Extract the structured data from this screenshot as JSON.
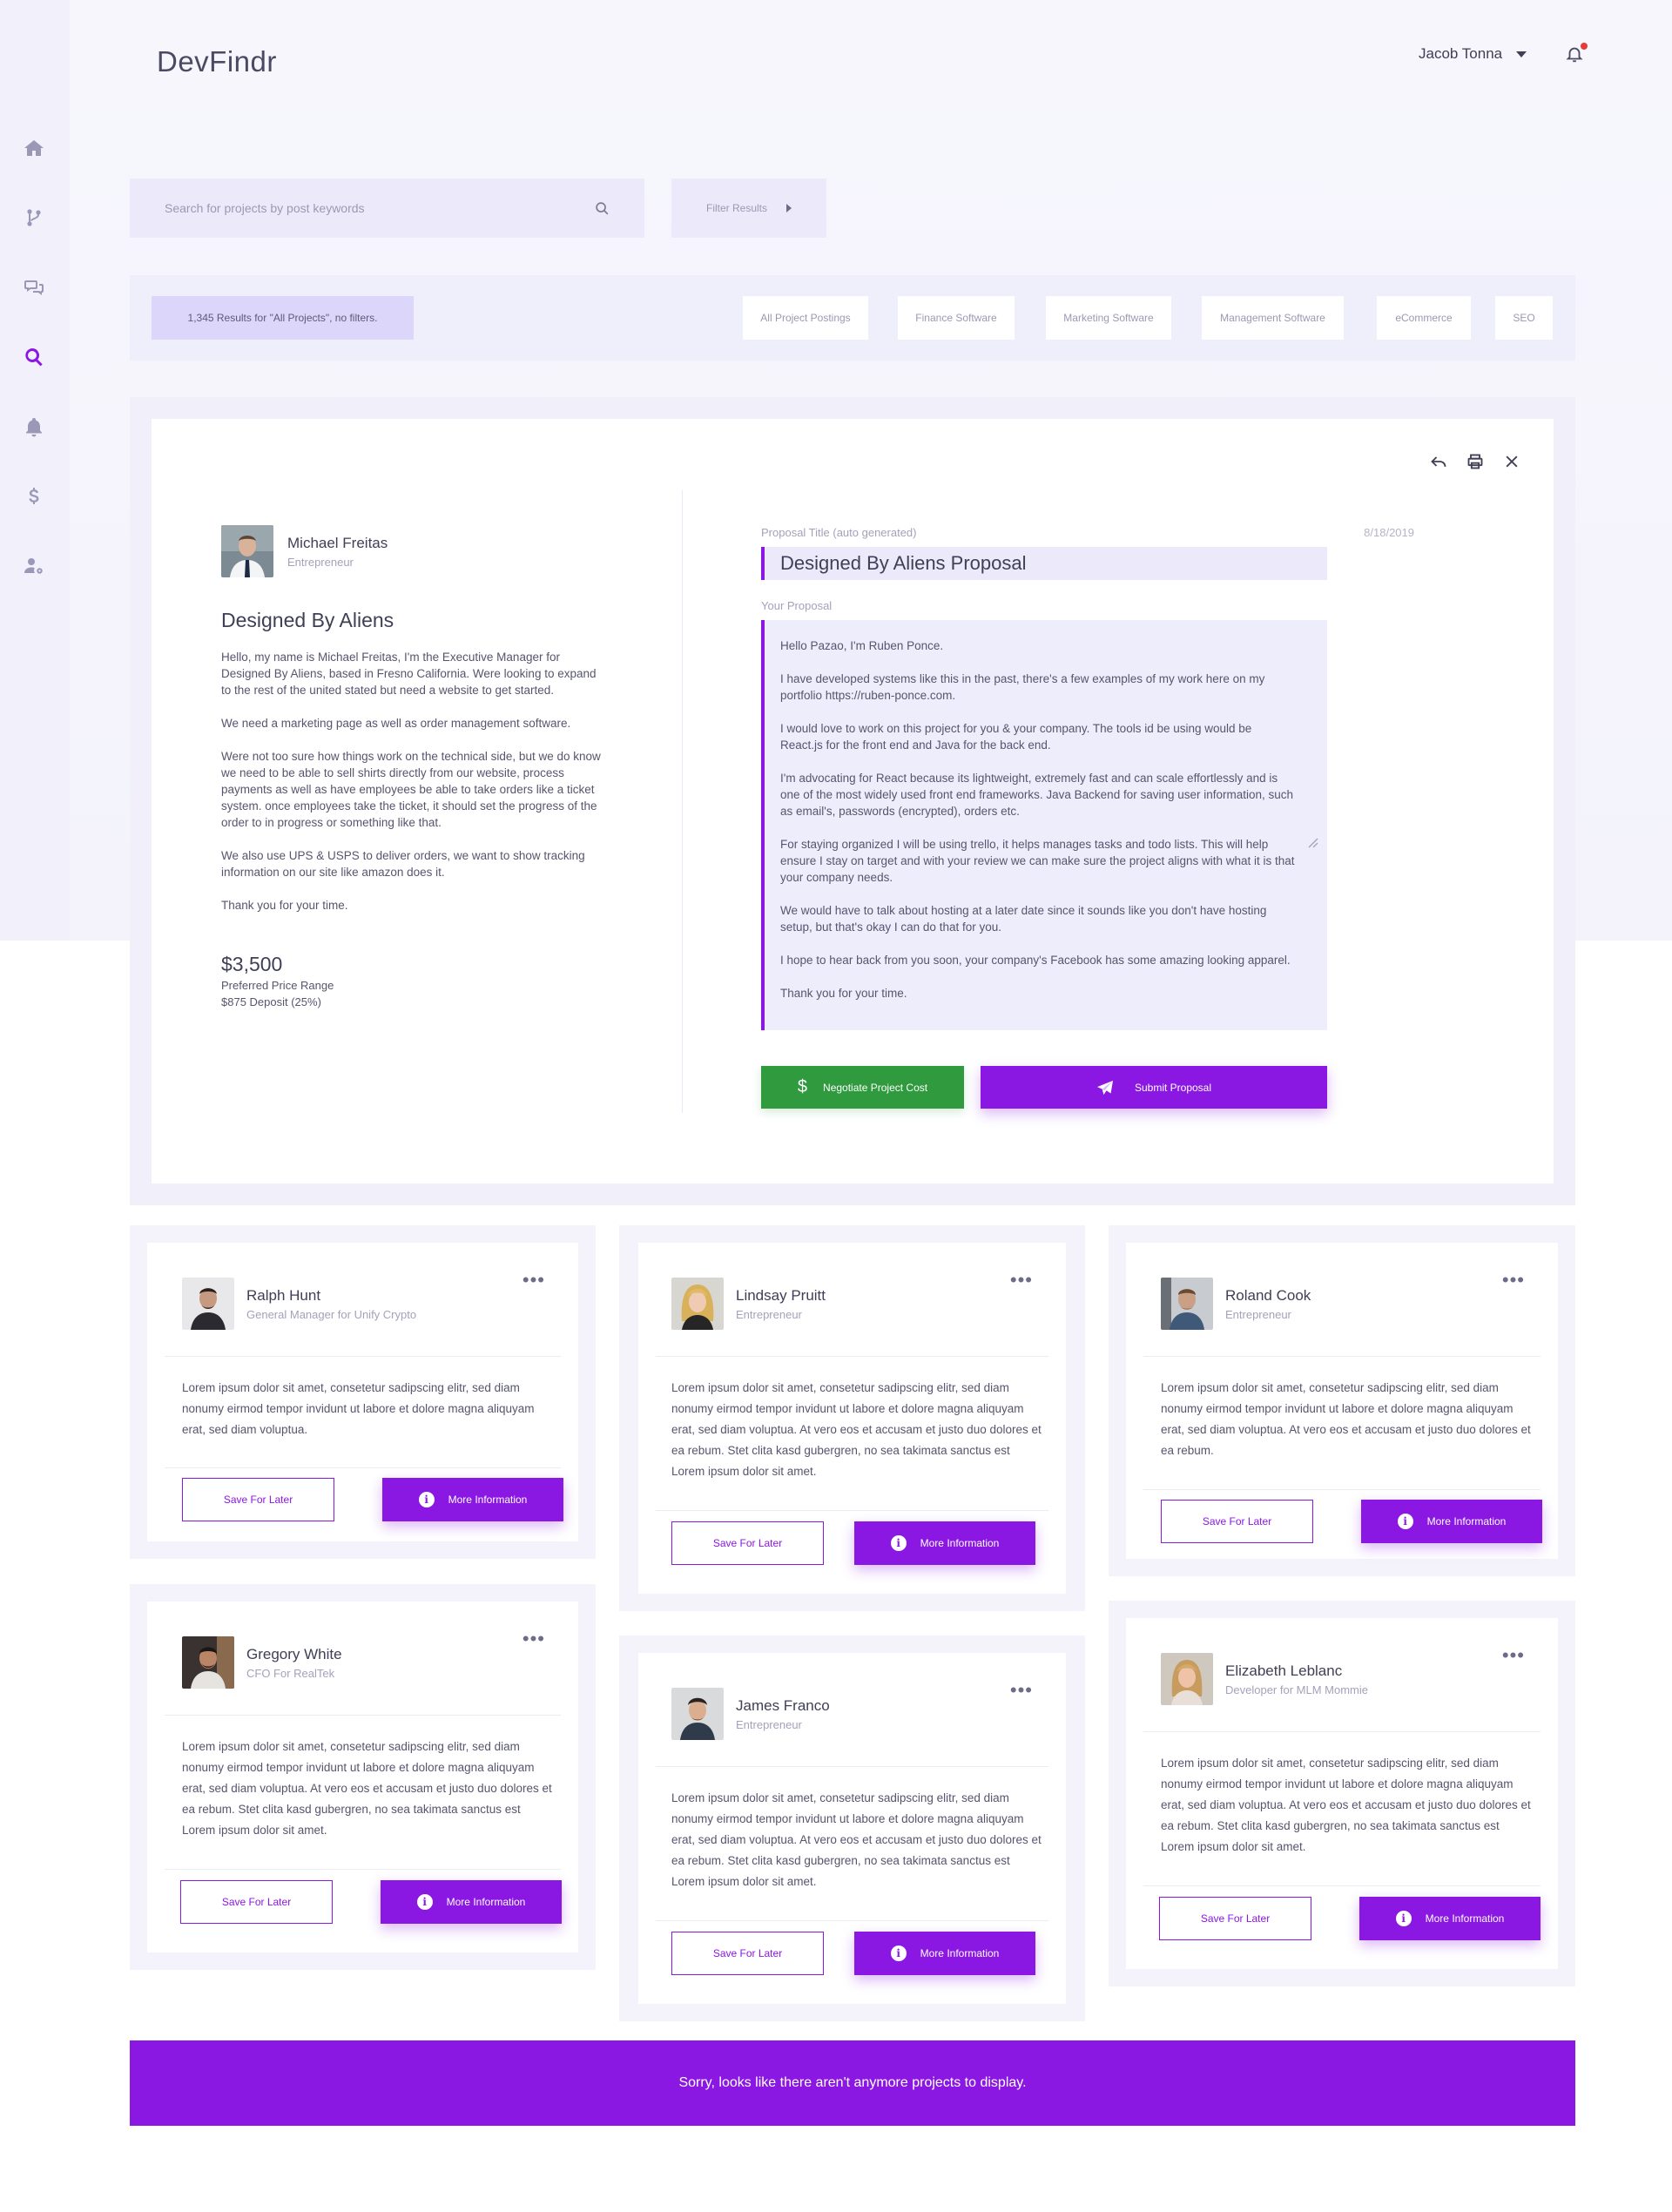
{
  "app": {
    "brand": "DevFindr"
  },
  "user": {
    "name": "Jacob Tonna"
  },
  "sidebar": {
    "items": [
      {
        "icon": "home-icon"
      },
      {
        "icon": "branch-icon"
      },
      {
        "icon": "chat-icon"
      },
      {
        "icon": "search-icon",
        "active": true
      },
      {
        "icon": "bell-icon"
      },
      {
        "icon": "dollar-icon"
      },
      {
        "icon": "user-settings-icon"
      }
    ]
  },
  "search": {
    "placeholder": "Search for projects by post keywords"
  },
  "filter": {
    "label": "Filter Results"
  },
  "results": {
    "count_text": "1,345 Results for \"All Projects\", no filters.",
    "chips": [
      "All Project Postings",
      "Finance Software",
      "Marketing Software",
      "Management Software",
      "eCommerce",
      "SEO"
    ]
  },
  "detail": {
    "poster_name": "Michael Freitas",
    "poster_role": "Entrepreneur",
    "project_title": "Designed By Aliens",
    "description": [
      "Hello, my name is Michael Freitas, I'm the Executive Manager for Designed By Aliens, based in Fresno California. Were looking to expand to the rest of the united stated but need a website to get started.",
      "We need a marketing page as well as order management software.",
      "Were not too sure how things work on the technical side, but we do know we need to be able to sell shirts directly from our website, process payments as well as have employees be able to take orders like a ticket system. once employees take the ticket, it should set the progress of the order to in progress or something like that.",
      "We also use UPS & USPS to deliver orders, we want to show tracking information on our site like amazon does it.",
      "Thank you for your time."
    ],
    "price": "$3,500",
    "price_label": "Preferred Price Range",
    "deposit": "$875 Deposit (25%)",
    "proposal_title_label": "Proposal Title (auto generated)",
    "proposal_date": "8/18/2019",
    "proposal_title": "Designed By Aliens Proposal",
    "your_proposal_label": "Your Proposal",
    "proposal_body": [
      "Hello Pazao, I'm Ruben Ponce.",
      "I have developed systems like this in the past, there's a few examples of my work here on my portfolio https://ruben-ponce.com.",
      "I would love to work on this project for you & your company. The tools id be using would be React.js for the front end and Java for the back end.",
      "I'm advocating for React because its lightweight, extremely fast and can scale effortlessly and is one of the most widely used front end frameworks. Java Backend for saving user information, such as email's, passwords (encrypted), orders etc.",
      "For staying organized I will be using trello, it helps manages tasks and todo lists. This will help ensure I stay on target and with your review we can make sure the project aligns with what it is that your company needs.",
      "We would have to talk about hosting at a later date since it sounds like you don't have hosting setup, but that's okay I can do that for you.",
      "I hope to hear back from you soon, your company's Facebook has some amazing looking apparel.",
      "Thank you for your time."
    ],
    "negotiate_label": "Negotiate Project Cost",
    "submit_label": "Submit Proposal"
  },
  "cards": [
    {
      "name": "Ralph Hunt",
      "role": "General Manager for Unify Crypto",
      "body": "Lorem ipsum dolor sit amet, consetetur sadipscing elitr, sed diam nonumy eirmod tempor invidunt ut labore et dolore magna aliquyam erat, sed diam voluptua.",
      "save": "Save For Later",
      "info": "More Information"
    },
    {
      "name": "Lindsay Pruitt",
      "role": "Entrepreneur",
      "body": "Lorem ipsum dolor sit amet, consetetur sadipscing elitr, sed diam nonumy eirmod tempor invidunt ut labore et dolore magna aliquyam erat, sed diam voluptua. At vero eos et accusam et justo duo dolores et ea rebum. Stet clita kasd gubergren, no sea takimata sanctus est Lorem ipsum dolor sit amet.",
      "save": "Save For Later",
      "info": "More Information"
    },
    {
      "name": "Roland Cook",
      "role": "Entrepreneur",
      "body": "Lorem ipsum dolor sit amet, consetetur sadipscing elitr, sed diam nonumy eirmod tempor invidunt ut labore et dolore magna aliquyam erat, sed diam voluptua. At vero eos et accusam et justo duo dolores et ea rebum.",
      "save": "Save For Later",
      "info": "More Information"
    },
    {
      "name": "Gregory White",
      "role": "CFO For RealTek",
      "body": "Lorem ipsum dolor sit amet, consetetur sadipscing elitr, sed diam nonumy eirmod tempor invidunt ut labore et dolore magna aliquyam erat, sed diam voluptua. At vero eos et accusam et justo duo dolores et ea rebum. Stet clita kasd gubergren, no sea takimata sanctus est Lorem ipsum dolor sit amet.",
      "save": "Save For Later",
      "info": "More Information"
    },
    {
      "name": "James Franco",
      "role": "Entrepreneur",
      "body": "Lorem ipsum dolor sit amet, consetetur sadipscing elitr, sed diam nonumy eirmod tempor invidunt ut labore et dolore magna aliquyam erat, sed diam voluptua. At vero eos et accusam et justo duo dolores et ea rebum. Stet clita kasd gubergren, no sea takimata sanctus est Lorem ipsum dolor sit amet.",
      "save": "Save For Later",
      "info": "More Information"
    },
    {
      "name": "Elizabeth Leblanc",
      "role": "Developer for MLM Mommie",
      "body": "Lorem ipsum dolor sit amet, consetetur sadipscing elitr, sed diam nonumy eirmod tempor invidunt ut labore et dolore magna aliquyam erat, sed diam voluptua. At vero eos et accusam et justo duo dolores et ea rebum. Stet clita kasd gubergren, no sea takimata sanctus est Lorem ipsum dolor sit amet.",
      "save": "Save For Later",
      "info": "More Information"
    }
  ],
  "footer": {
    "message": "Sorry, looks like there aren't anymore projects to display."
  }
}
